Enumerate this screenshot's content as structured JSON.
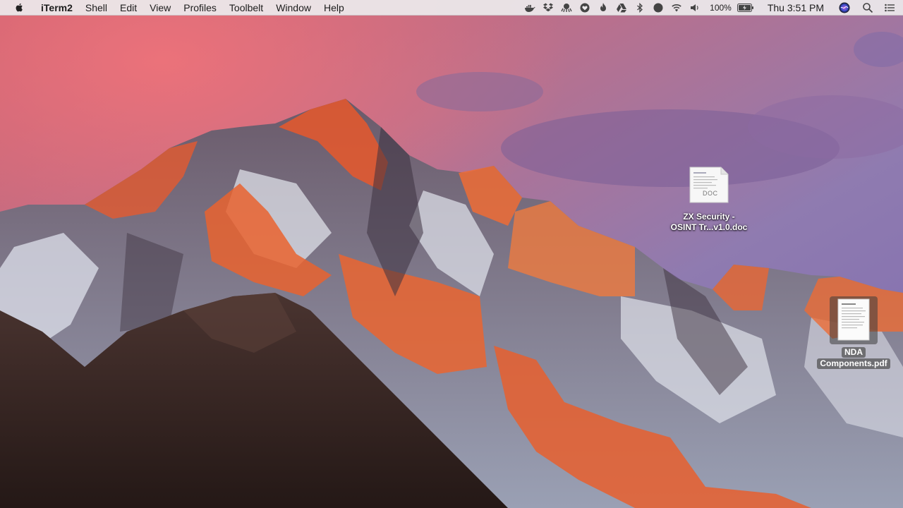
{
  "menubar": {
    "app_name": "iTerm2",
    "menus": [
      "Shell",
      "Edit",
      "View",
      "Profiles",
      "Toolbelt",
      "Window",
      "Help"
    ],
    "tray_icons": [
      "docker-icon",
      "dropbox-icon",
      "octopus-icon",
      "heart-icon",
      "flame-icon",
      "google-drive-icon",
      "bluetooth-icon",
      "record-icon",
      "wifi-icon",
      "volume-icon"
    ],
    "battery_percent": "100%",
    "clock": "Thu 3:51 PM"
  },
  "desktop": {
    "files": [
      {
        "name_line1": "ZX Security -",
        "name_line2": "OSINT Tr...v1.0.doc",
        "doc_badge": "DOC"
      },
      {
        "name_line1": "NDA",
        "name_line2": "Components.pdf"
      }
    ]
  }
}
